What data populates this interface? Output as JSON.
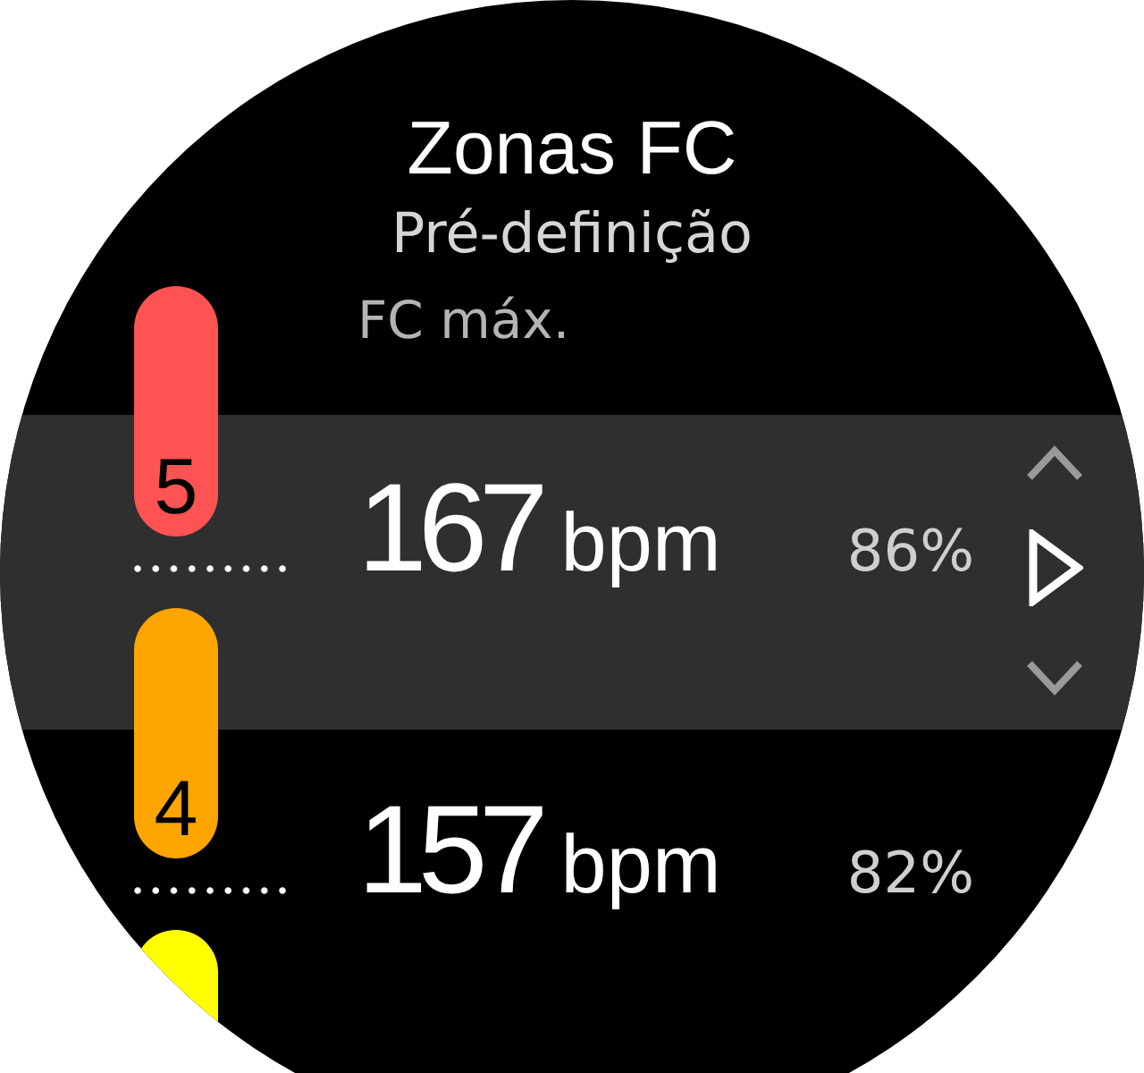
{
  "screen": {
    "title": "Zonas FC",
    "subtitle": "Pré-definição",
    "column_header": "FC máx."
  },
  "zones": [
    {
      "zone": "5",
      "color": "#fd5353",
      "value": "167",
      "unit": "bpm",
      "percent": "86%",
      "selected": true
    },
    {
      "zone": "4",
      "color": "#ffa500",
      "value": "157",
      "unit": "bpm",
      "percent": "82%",
      "selected": false
    },
    {
      "color": "#ffff00",
      "selected": false
    }
  ]
}
